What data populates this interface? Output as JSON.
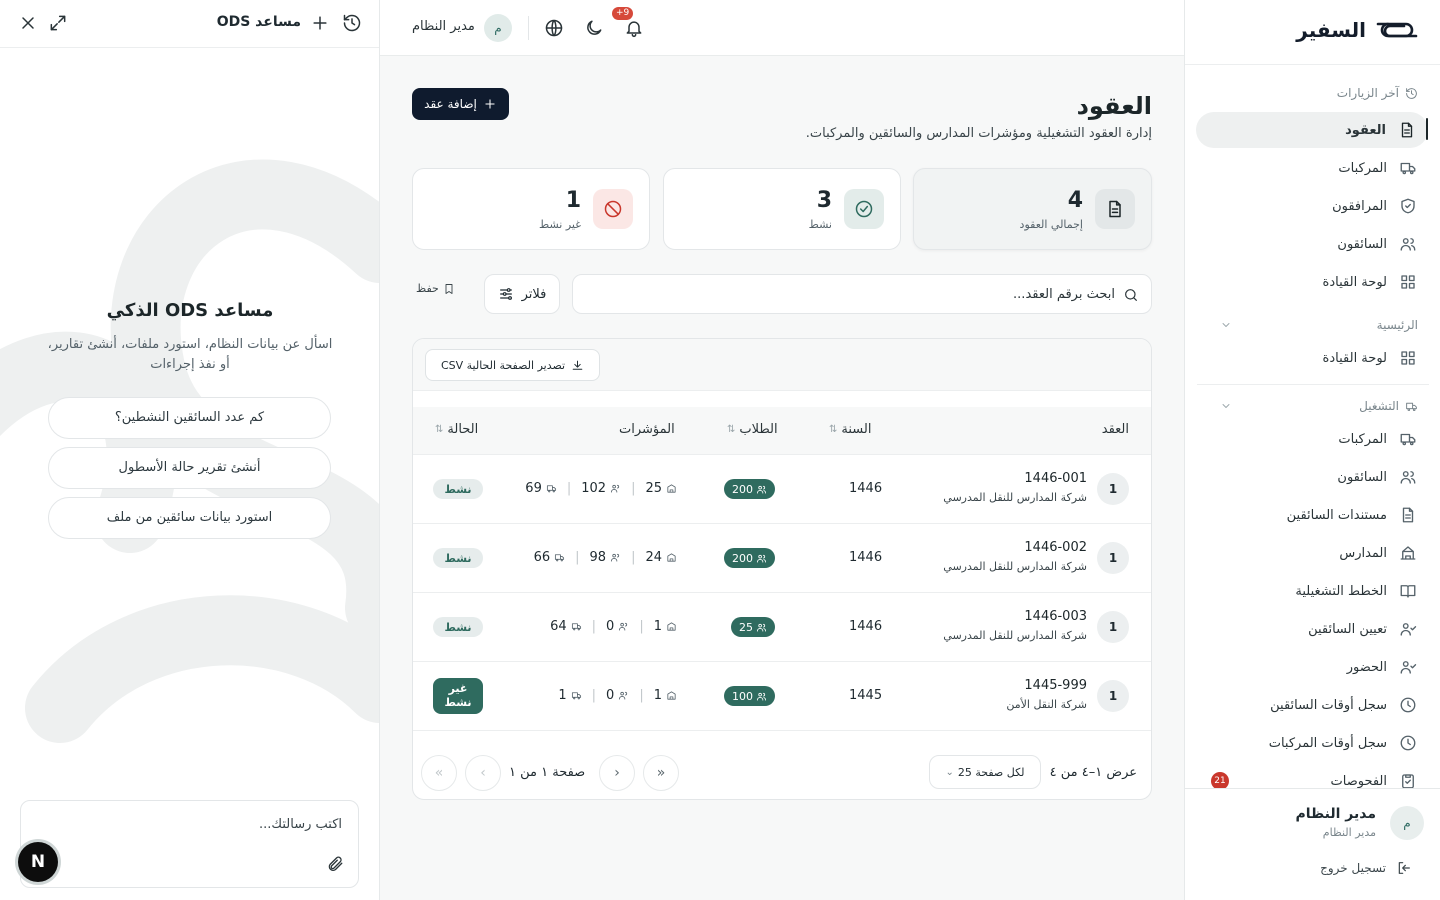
{
  "assistant": {
    "title": "مساعد ODS",
    "heading": "مساعد ODS الذكي",
    "description": "اسأل عن بيانات النظام، استورد ملفات، أنشئ تقارير، أو نفذ إجراءات",
    "suggestions": [
      "كم عدد السائقين النشطين؟",
      "أنشئ تقرير حالة الأسطول",
      "استورد بيانات سائقين من ملف"
    ],
    "input_placeholder": "اكتب رسالتك...",
    "fab_label": "N"
  },
  "topbar": {
    "notification_count": "+9",
    "user_initial": "م",
    "user_name": "مدير النظام"
  },
  "page": {
    "title": "العقود",
    "subtitle": "إدارة العقود التشغيلية ومؤشرات المدارس والسائقين والمركبات.",
    "add_button": "إضافة عقد"
  },
  "stats": [
    {
      "value": "4",
      "label": "إجمالي العقود",
      "icon": "document-icon"
    },
    {
      "value": "3",
      "label": "نشط",
      "icon": "check-circle-icon"
    },
    {
      "value": "1",
      "label": "غير نشط",
      "icon": "ban-icon"
    }
  ],
  "toolbar": {
    "search_placeholder": "ابحث برقم العقد...",
    "filters_label": "فلاتر",
    "save_label": "حفظ",
    "export_label": "تصدير الصفحة الحالية CSV"
  },
  "table": {
    "columns": {
      "contract": "العقد",
      "year": "السنة",
      "students": "الطلاب",
      "indicators": "المؤشرات",
      "status": "الحالة"
    },
    "rows": [
      {
        "idx": "1",
        "number": "1446-001",
        "company": "شركة المدارس للنقل المدرسي",
        "year": "1446",
        "students": "200",
        "schools": "25",
        "drivers": "102",
        "vehicles": "69",
        "status": "نشط"
      },
      {
        "idx": "1",
        "number": "1446-002",
        "company": "شركة المدارس للنقل المدرسي",
        "year": "1446",
        "students": "200",
        "schools": "24",
        "drivers": "98",
        "vehicles": "66",
        "status": "نشط"
      },
      {
        "idx": "1",
        "number": "1446-003",
        "company": "شركة المدارس للنقل المدرسي",
        "year": "1446",
        "students": "25",
        "schools": "1",
        "drivers": "0",
        "vehicles": "64",
        "status": "نشط"
      },
      {
        "idx": "1",
        "number": "1445-999",
        "company": "شركة النقل الأمن",
        "year": "1445",
        "students": "100",
        "schools": "1",
        "drivers": "0",
        "vehicles": "1",
        "status": "غير نشط"
      }
    ]
  },
  "pager": {
    "count_text": "عرض ١–٤ من ٤",
    "per_page": "لكل صفحة 25",
    "page_text": "صفحة ١ من ١"
  },
  "sidebar": {
    "brand": "السفير",
    "recent_label": "آخر الزيارات",
    "recent_items": [
      "العقود",
      "المركبات",
      "المرافقون",
      "السائقون",
      "لوحة القيادة"
    ],
    "main_label": "الرئيسية",
    "main_items": [
      "لوحة القيادة"
    ],
    "ops_label": "التشغيل",
    "ops_items": [
      "المركبات",
      "السائقون",
      "مستندات السائقين",
      "المدارس",
      "الخطط التشغيلية",
      "تعيين السائقين",
      "الحضور",
      "سجل أوقات السائقين",
      "سجل أوقات المركبات",
      "الفحوصات"
    ],
    "inspections_badge": "21",
    "user_initial": "م",
    "user_name": "مدير النظام",
    "user_role": "مدير النظام",
    "logout_label": "تسجيل خروج"
  }
}
